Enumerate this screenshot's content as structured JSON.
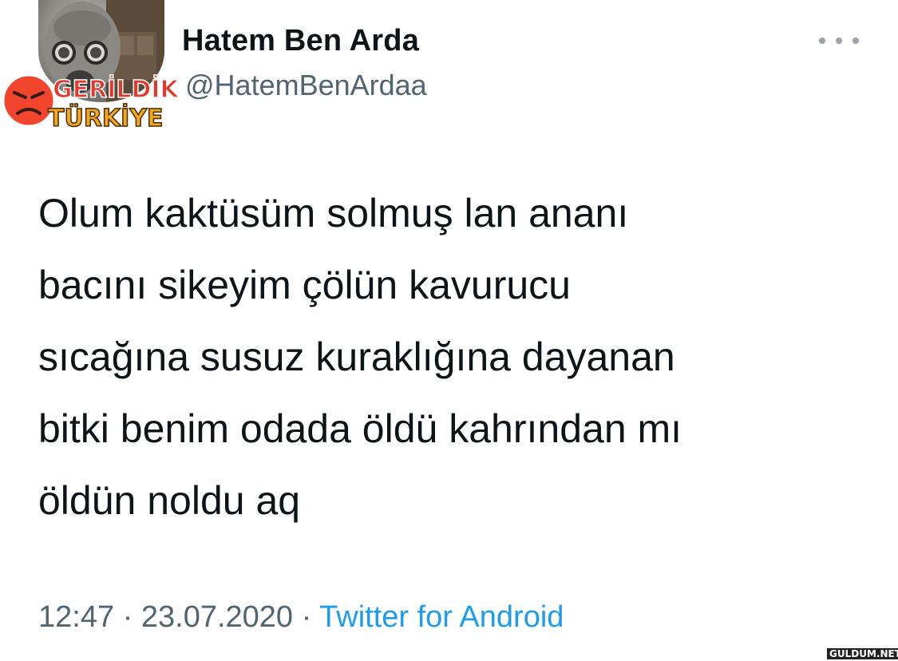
{
  "tweet": {
    "display_name": "Hatem Ben Arda",
    "handle": "@HatemBenArdaa",
    "text_lines": [
      "Olum kaktüsüm solmuş lan ananı",
      "bacını sikeyim çölün kavurucu",
      "sıcağına susuz kuraklığına dayanan",
      "bitki benim odada öldü kahrından mı",
      "öldün noldu aq"
    ],
    "time": "12:47",
    "date": "23.07.2020",
    "separator": "·",
    "source": "Twitter for Android"
  },
  "icons": {
    "more": "more-horizontal-icon",
    "avatar": "avatar-gasmask-photo"
  },
  "watermark": {
    "line1": "GERİLDİK",
    "line2": "TÜRKİYE",
    "site": "GULDUM.NET"
  },
  "colors": {
    "text": "#0f1419",
    "secondary": "#536471",
    "link": "#1d9bf0"
  }
}
